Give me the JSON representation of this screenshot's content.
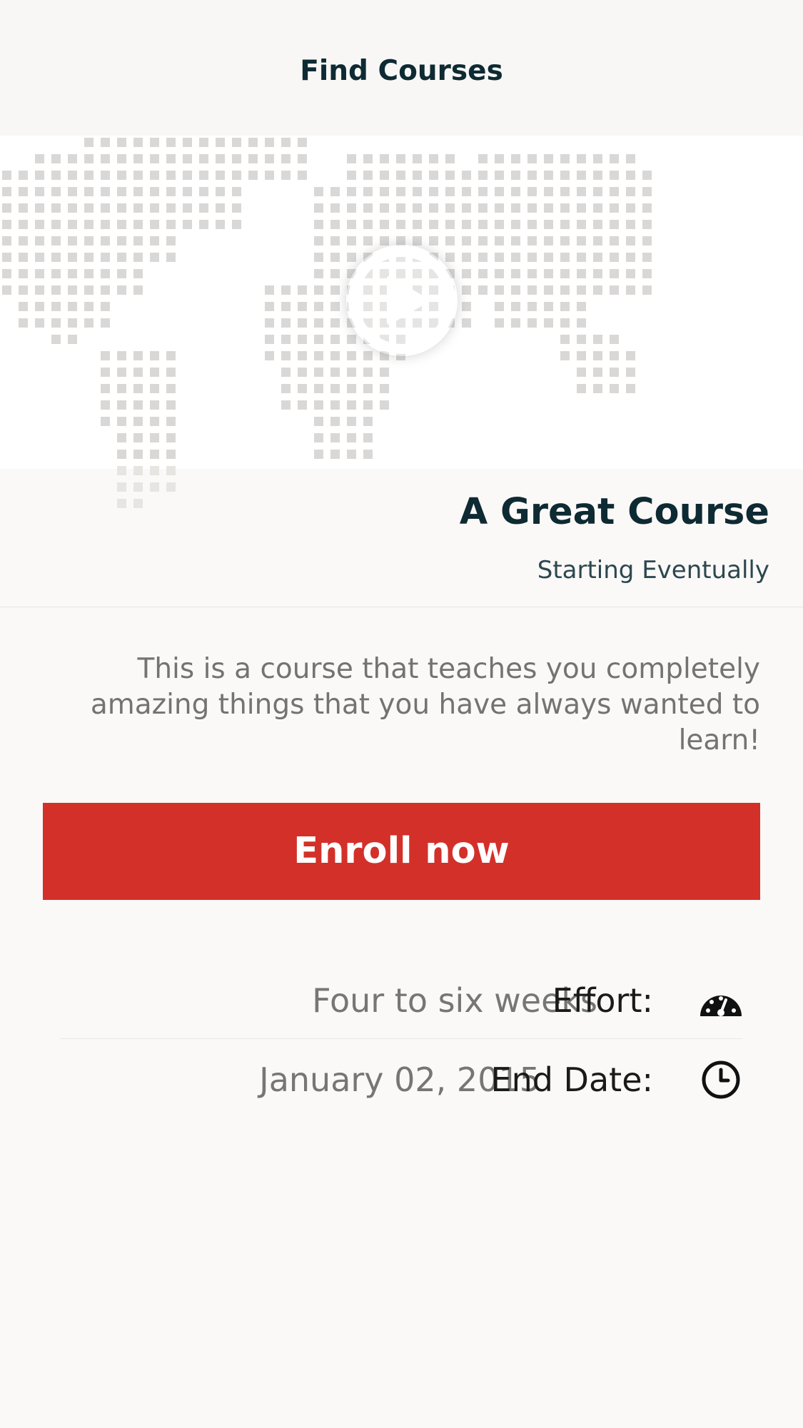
{
  "nav": {
    "title": "Find Courses"
  },
  "hero": {
    "play_icon": "play-circle-icon"
  },
  "course": {
    "title": "A Great Course",
    "start": "Starting Eventually",
    "description": "This is a course that teaches you completely amazing things that you have always wanted to learn!",
    "enroll_label": "Enroll now"
  },
  "details": {
    "effort": {
      "value": "Four to six weeks",
      "label": "Effort:",
      "icon": "dashboard-gauge-icon"
    },
    "end_date": {
      "value": "January 02, 2015",
      "label": "End Date:",
      "icon": "clock-icon"
    }
  },
  "colors": {
    "accent": "#d3302a",
    "title_text": "#0e2a33",
    "background": "#faf9f7"
  }
}
